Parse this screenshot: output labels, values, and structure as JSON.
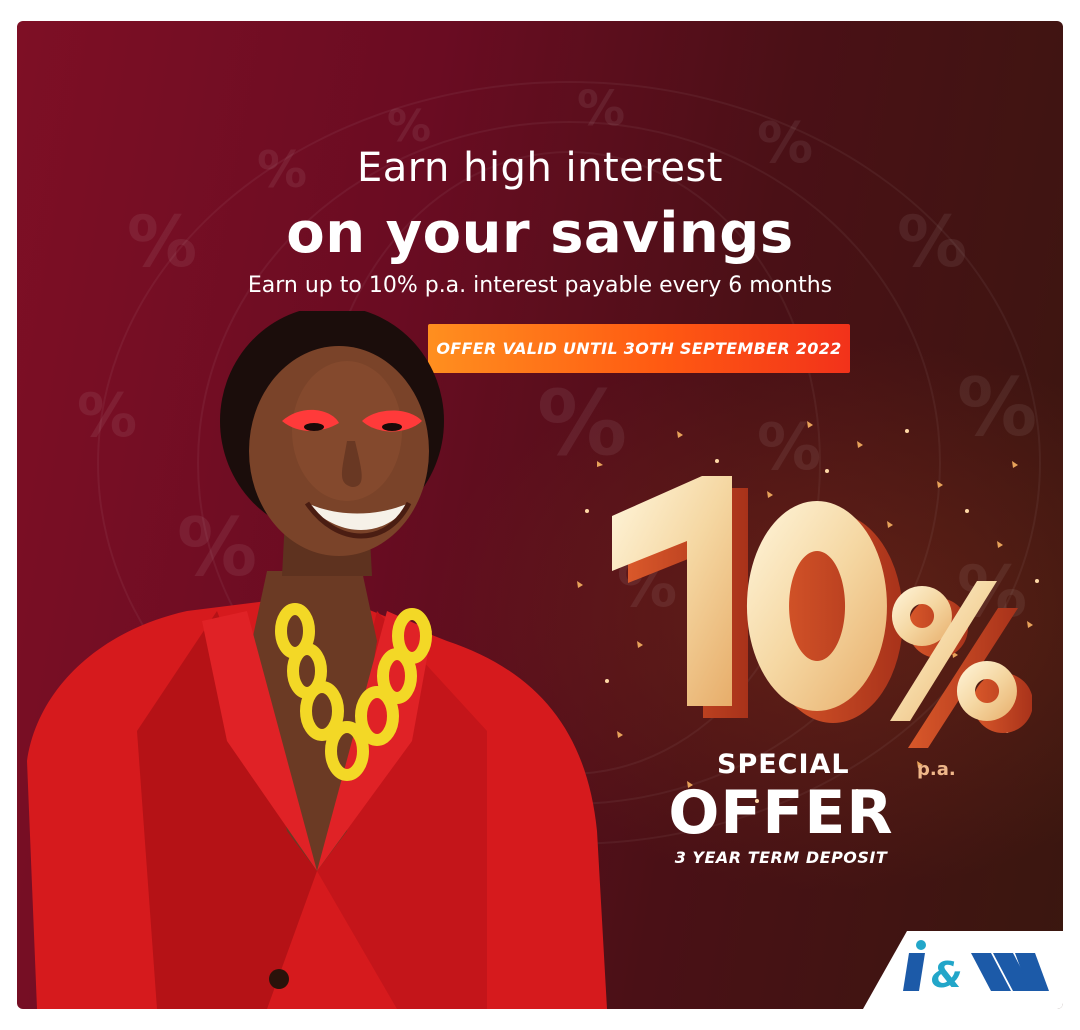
{
  "ad": {
    "headline_line1": "Earn high interest",
    "headline_line2": "on your savings",
    "subline": "Earn up to 10% p.a. interest payable every 6 months",
    "offer_banner": "OFFER VALID UNTIL 3OTH SEPTEMBER 2022",
    "rate": "10%",
    "rate_suffix": "p.a.",
    "special": "SPECIAL",
    "offer": "OFFER",
    "term": "3 YEAR TERM DEPOSIT"
  },
  "brand": {
    "logo_text": "I&M",
    "colors": {
      "background_red": "#7e0f25",
      "banner_orange": "#ff5a12",
      "logo_blue": "#1c5aa8",
      "logo_teal": "#22a6c9"
    }
  },
  "icons": {
    "percent_pattern": "percent-sign-pattern",
    "person_photo": "woman-in-red-blazer"
  }
}
